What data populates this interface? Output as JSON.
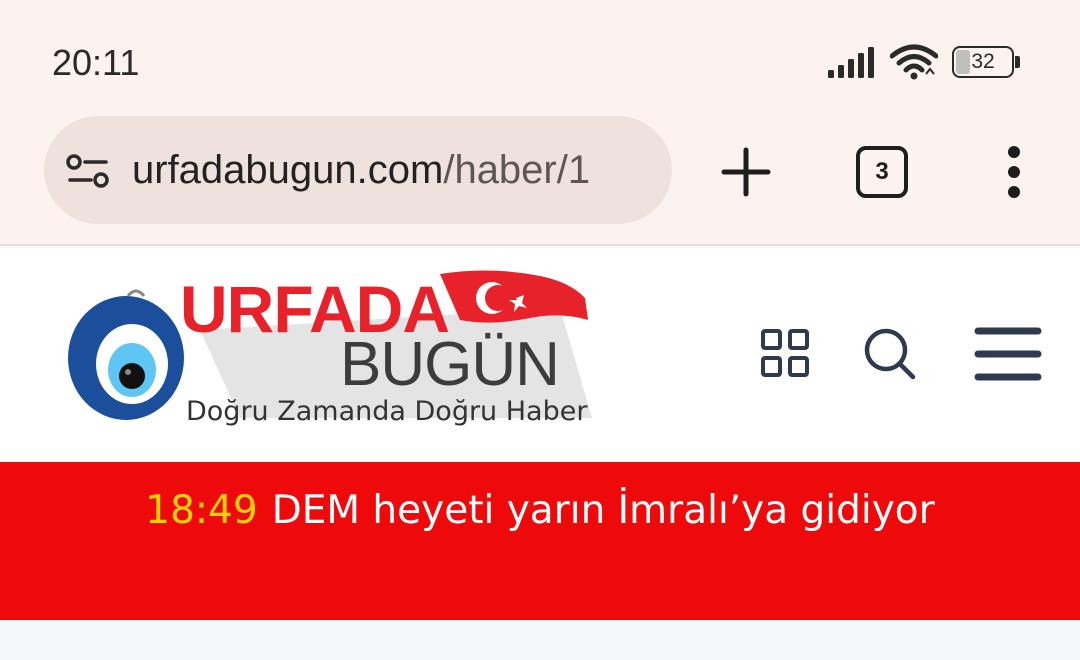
{
  "status_bar": {
    "time": "20:11",
    "battery_level": "32",
    "icons": [
      "signal-icon",
      "wifi-icon",
      "battery-icon"
    ]
  },
  "browser": {
    "url_domain": "urfadabugun.com",
    "url_path": "/haber/1",
    "tab_count": "3",
    "icons": [
      "site-settings-icon",
      "plus-icon",
      "tabs-icon",
      "more-vert-icon"
    ]
  },
  "site": {
    "logo_title": "URFADA",
    "logo_subtitle": "BUGÜN",
    "logo_tagline": "Doğru Zamanda Doğru Haber",
    "icons": [
      "grid-icon",
      "search-icon",
      "hamburger-menu-icon"
    ]
  },
  "ticker": {
    "time": "18:49",
    "headline": "DEM heyeti yarın İmralı’ya gidiyor"
  },
  "colors": {
    "chrome_bg": "#fcf3f0",
    "url_pill": "#efe2dd",
    "ticker_red": "#ee0a0b",
    "ticker_time": "#ffd400",
    "logo_red": "#e8222a",
    "header_icons": "#2e3a4f"
  }
}
